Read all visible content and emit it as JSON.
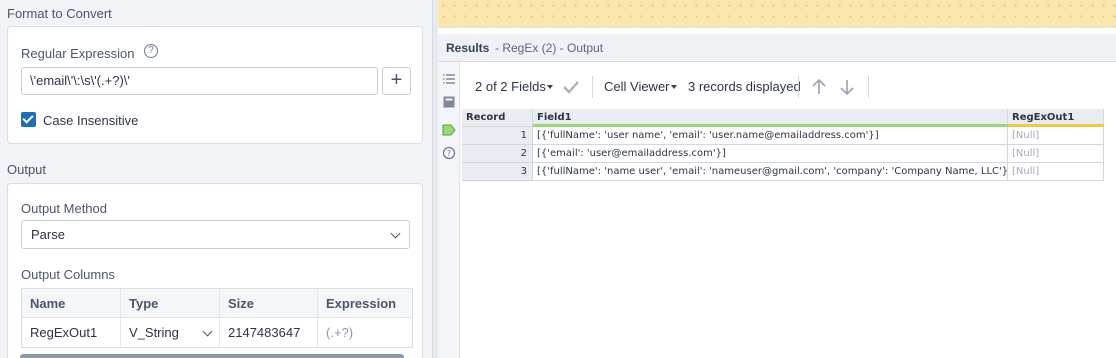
{
  "config": {
    "format_section_title": "Format to Convert",
    "regex_label": "Regular Expression",
    "regex_value": "\\'email\\'\\:\\s\\'(.+?)\\'",
    "add_button": "+",
    "case_insensitive_label": "Case Insensitive",
    "case_insensitive_checked": true,
    "output_section_title": "Output",
    "output_method_label": "Output Method",
    "output_method_value": "Parse",
    "output_columns_label": "Output Columns",
    "columns_headers": [
      "Name",
      "Type",
      "Size",
      "Expression"
    ],
    "columns_rows": [
      {
        "name": "RegExOut1",
        "type": "V_String",
        "size": "2147483647",
        "expression": "(.+?)"
      }
    ]
  },
  "results": {
    "title": "Results",
    "subtitle": "- RegEx (2) - Output",
    "fields_selector": "2 of 2 Fields",
    "cell_viewer": "Cell Viewer",
    "records_displayed": "3 records displayed"
  },
  "grid": {
    "headers": [
      "Record",
      "Field1",
      "RegExOut1"
    ],
    "rows": [
      {
        "record": "1",
        "field1": "[{'fullName': 'user name', 'email': 'user.name@emailaddress.com'}]",
        "out": "[Null]"
      },
      {
        "record": "2",
        "field1": "[{'email': 'user@emailaddress.com'}]",
        "out": "[Null]"
      },
      {
        "record": "3",
        "field1": "[{'fullName': 'name user', 'email': 'nameuser@gmail.com', 'company': 'Company Name, LLC'}]",
        "out": "[Null]"
      }
    ]
  },
  "colors": {
    "accent_blue": "#1f6fb8",
    "canvas_yellow": "#fbe7ae",
    "field_underline_green": "#9dd57b",
    "out_underline_yellow": "#f2c84b"
  },
  "icons": [
    "help-icon",
    "plus-icon",
    "check-icon",
    "chevron-down-icon",
    "list-icon",
    "table-icon",
    "tag-icon",
    "question-icon",
    "checkmark-icon",
    "arrow-up-icon",
    "arrow-down-icon"
  ]
}
